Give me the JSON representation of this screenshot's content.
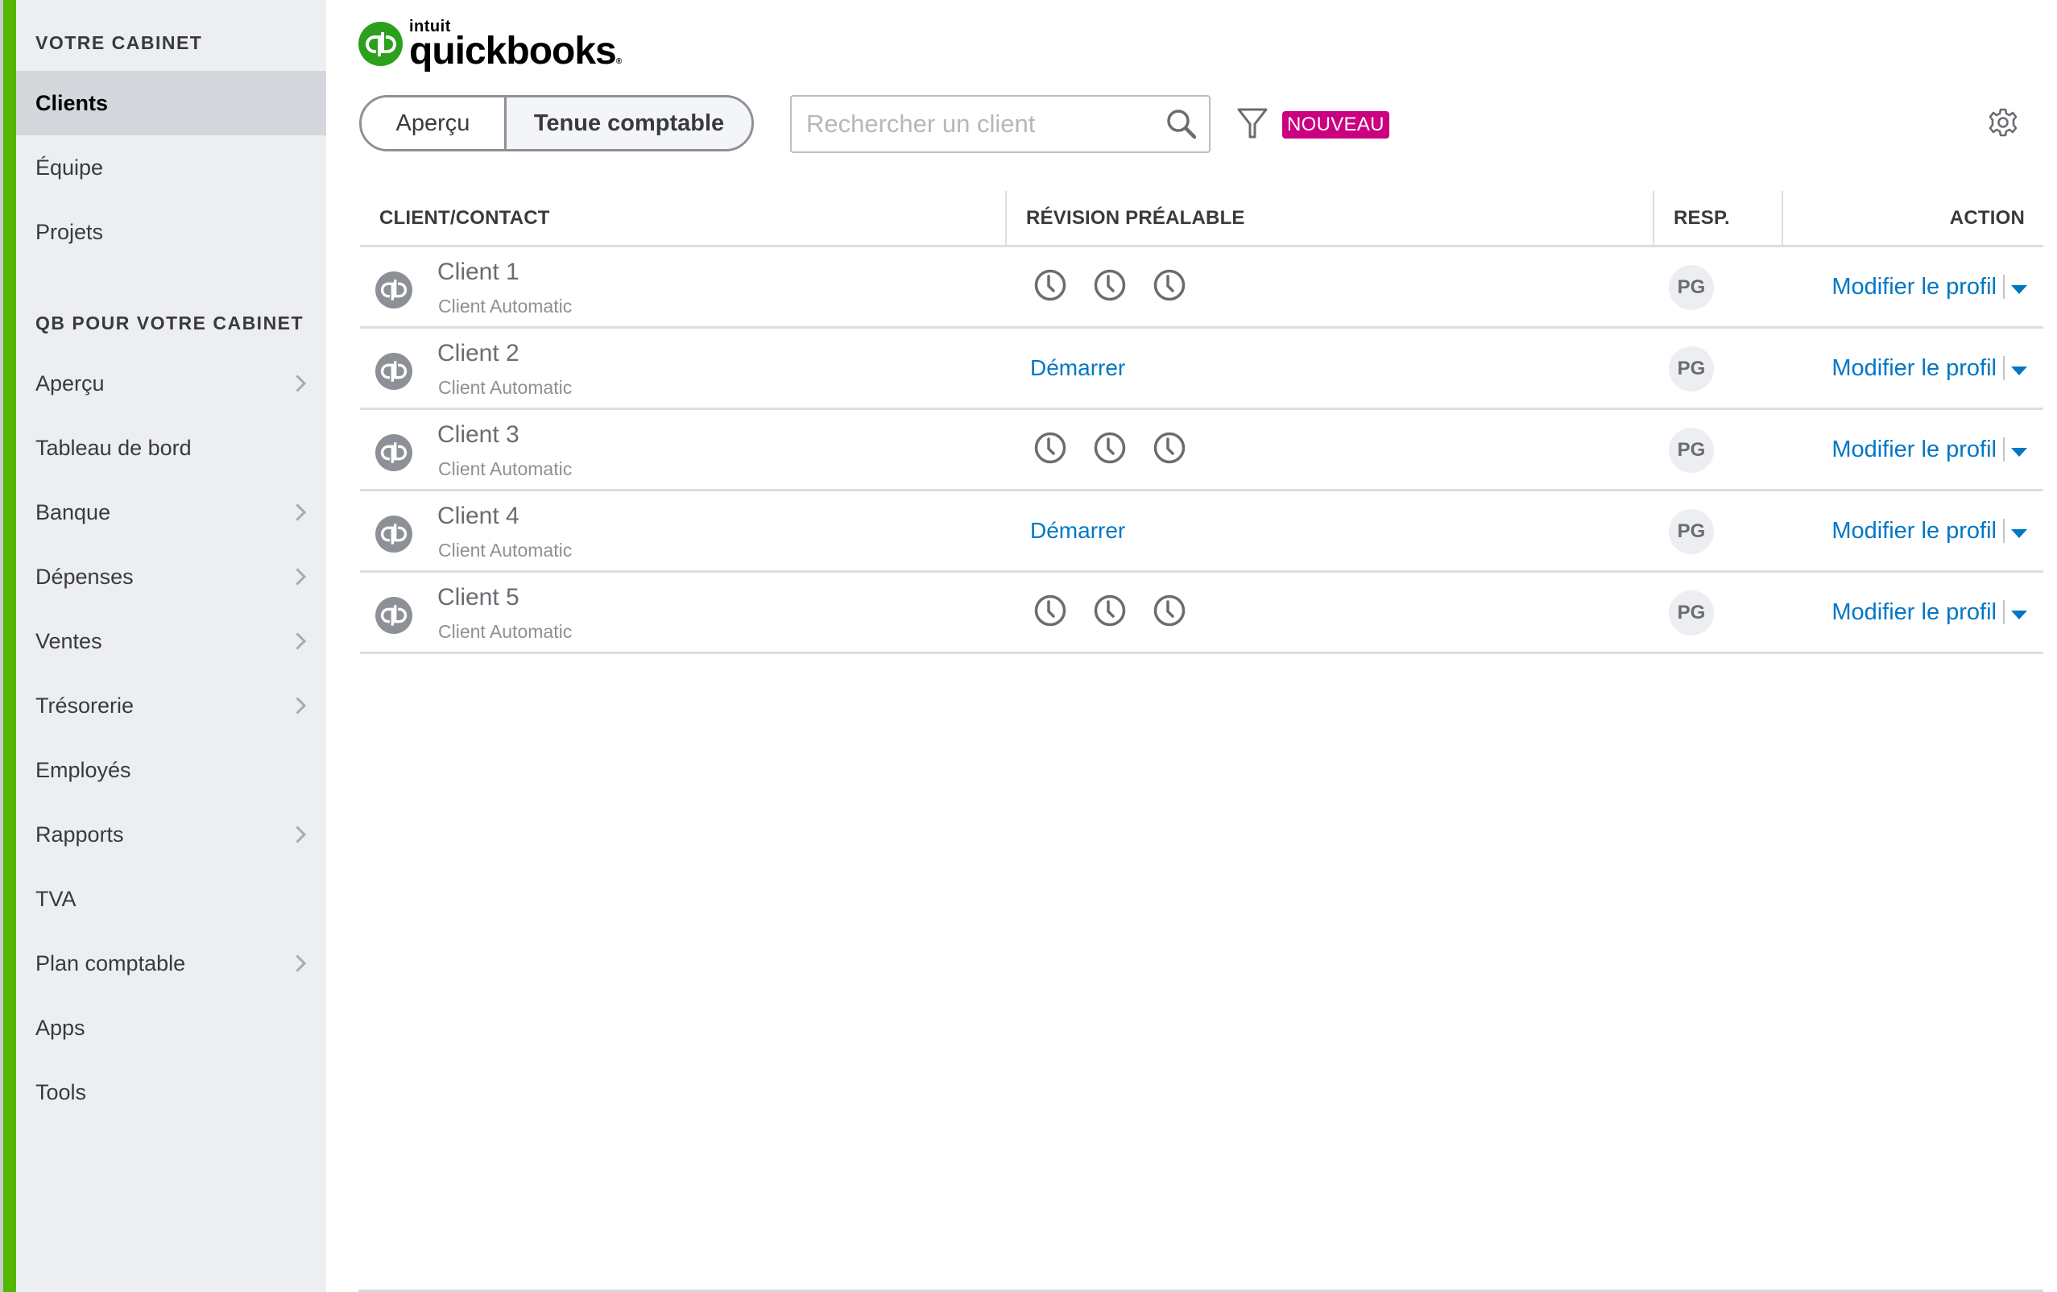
{
  "sidebar": {
    "section1": "VOTRE CABINET",
    "firm_items": [
      {
        "label": "Clients",
        "active": true,
        "has_children": false
      },
      {
        "label": "Équipe",
        "active": false,
        "has_children": false
      },
      {
        "label": "Projets",
        "active": false,
        "has_children": false
      }
    ],
    "section2": "QB POUR VOTRE CABINET",
    "qb_items": [
      {
        "label": "Aperçu",
        "has_children": true
      },
      {
        "label": "Tableau de bord",
        "has_children": false
      },
      {
        "label": "Banque",
        "has_children": true
      },
      {
        "label": "Dépenses",
        "has_children": true
      },
      {
        "label": "Ventes",
        "has_children": true
      },
      {
        "label": "Trésorerie",
        "has_children": true
      },
      {
        "label": "Employés",
        "has_children": false
      },
      {
        "label": "Rapports",
        "has_children": true
      },
      {
        "label": "TVA",
        "has_children": false
      },
      {
        "label": "Plan comptable",
        "has_children": true
      },
      {
        "label": "Apps",
        "has_children": false
      },
      {
        "label": "Tools",
        "has_children": false
      }
    ]
  },
  "header": {
    "logo_intuit": "intuit",
    "logo_quickbooks": "quickbooks",
    "logo_mark": "qb",
    "tabs": [
      {
        "label": "Aperçu",
        "selected": false
      },
      {
        "label": "Tenue comptable",
        "selected": true
      }
    ],
    "search": {
      "placeholder": "Rechercher un client",
      "value": ""
    },
    "filter_icon": "filter-icon",
    "new_badge": "NOUVEAU",
    "settings_icon": "gear-icon"
  },
  "table": {
    "columns": [
      "CLIENT/CONTACT",
      "RÉVISION PRÉALABLE",
      "RESP.",
      "ACTION"
    ],
    "rows": [
      {
        "name": "Client 1",
        "type": "Client Automatic",
        "review": "pending",
        "review_label": "",
        "resp": "PG",
        "action": "Modifier le profil"
      },
      {
        "name": "Client 2",
        "type": "Client Automatic",
        "review": "start",
        "review_label": "Démarrer",
        "resp": "PG",
        "action": "Modifier le profil"
      },
      {
        "name": "Client 3",
        "type": "Client Automatic",
        "review": "pending",
        "review_label": "",
        "resp": "PG",
        "action": "Modifier le profil"
      },
      {
        "name": "Client 4",
        "type": "Client Automatic",
        "review": "start",
        "review_label": "Démarrer",
        "resp": "PG",
        "action": "Modifier le profil"
      },
      {
        "name": "Client 5",
        "type": "Client Automatic",
        "review": "pending",
        "review_label": "",
        "resp": "PG",
        "action": "Modifier le profil"
      }
    ]
  },
  "colors": {
    "brand_green": "#2ca01c",
    "sidebar_accent": "#53b700",
    "link_blue": "#0077c5",
    "badge_magenta": "#cb0080"
  }
}
